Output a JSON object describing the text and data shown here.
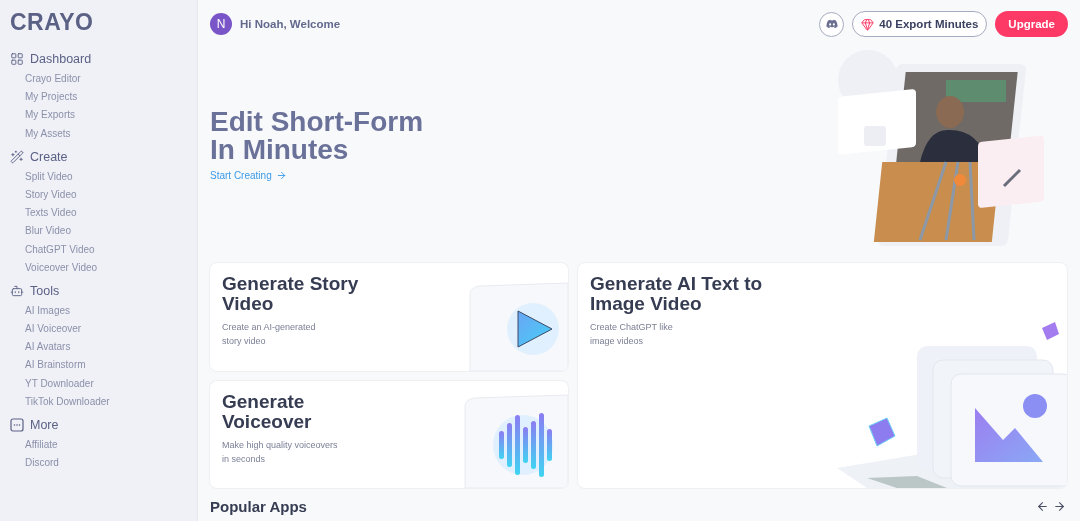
{
  "brand": {
    "logo": "CRAYO"
  },
  "sidebar": {
    "sections": [
      {
        "kind": "dashboard",
        "title": "Dashboard",
        "items": [
          "Crayo Editor",
          "My Projects",
          "My Exports",
          "My Assets"
        ]
      },
      {
        "kind": "create",
        "title": "Create",
        "items": [
          "Split Video",
          "Story Video",
          "Texts Video",
          "Blur Video",
          "ChatGPT Video",
          "Voiceover Video"
        ]
      },
      {
        "kind": "tools",
        "title": "Tools",
        "items": [
          "AI Images",
          "AI Voiceover",
          "AI Avatars",
          "AI Brainstorm",
          "YT Downloader",
          "TikTok Downloader"
        ]
      },
      {
        "kind": "more",
        "title": "More",
        "items": [
          "Affiliate",
          "Discord"
        ]
      }
    ]
  },
  "header": {
    "avatar": "N",
    "greeting": "Hi Noah, Welcome",
    "export_minutes": "40 Export Minutes",
    "upgrade": "Upgrade"
  },
  "hero": {
    "title_lines": [
      "Edit Short-Form",
      "In Minutes"
    ],
    "link": "Start Creating",
    "picture": {
      "kind": "picture"
    }
  },
  "cards": [
    {
      "kind": "story",
      "title": "Generate Story Video",
      "description_lines": [
        "Create an AI-generated",
        "story video"
      ]
    },
    {
      "kind": "voiceover",
      "title": "Generate Voiceover",
      "description_lines": [
        "Make high quality voiceovers",
        "in seconds"
      ]
    },
    {
      "title": "Generate AI Text to Image Video",
      "description_lines": [
        "Create ChatGPT like",
        "image videos"
      ]
    }
  ],
  "popular_apps": {
    "title": "Popular Apps"
  }
}
